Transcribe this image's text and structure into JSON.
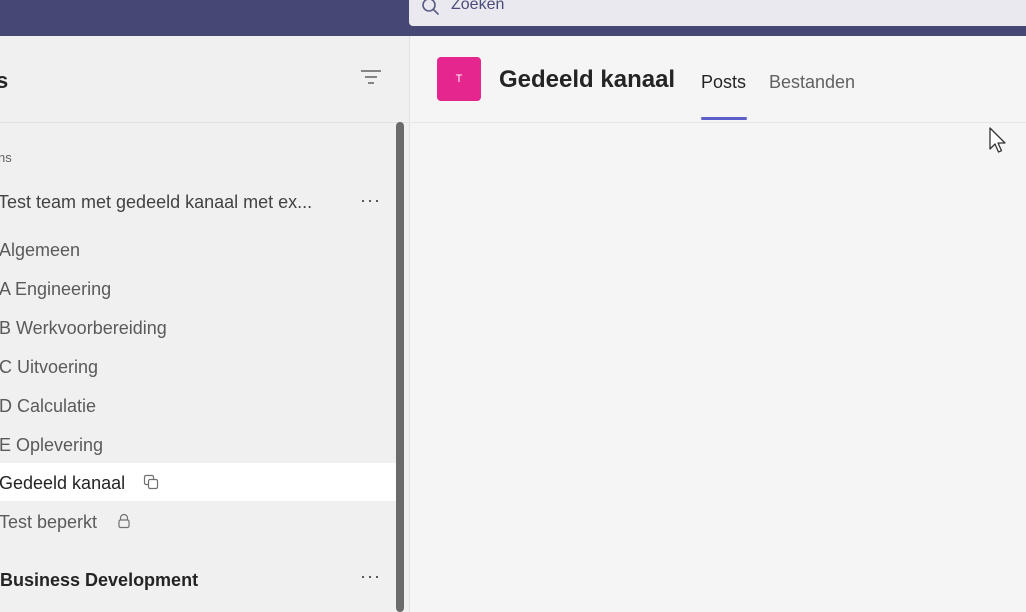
{
  "search": {
    "placeholder": "Zoeken",
    "icon": "search-icon"
  },
  "sidebar": {
    "title": "s",
    "section_label": "ns",
    "team": {
      "name": "Test team met gedeeld kanaal met ex...",
      "more": "···"
    },
    "channels": [
      {
        "label": "Algemeen"
      },
      {
        "label": "A Engineering"
      },
      {
        "label": "B Werkvoorbereiding"
      },
      {
        "label": "C Uitvoering"
      },
      {
        "label": "D Calculatie"
      },
      {
        "label": "E Oplevering"
      },
      {
        "label": "Gedeeld kanaal",
        "icon": "shared-channel-icon",
        "active": true
      },
      {
        "label": "Test beperkt",
        "icon": "lock-icon"
      }
    ],
    "team2": {
      "name": "Business Development",
      "more": "···"
    }
  },
  "main": {
    "avatar_letter": "T",
    "channel_title": "Gedeeld kanaal",
    "tabs": [
      {
        "label": "Posts",
        "active": true
      },
      {
        "label": "Bestanden"
      }
    ]
  },
  "colors": {
    "topbar": "#464775",
    "avatar": "#e4268e",
    "tab_accent": "#5b5fc7"
  }
}
